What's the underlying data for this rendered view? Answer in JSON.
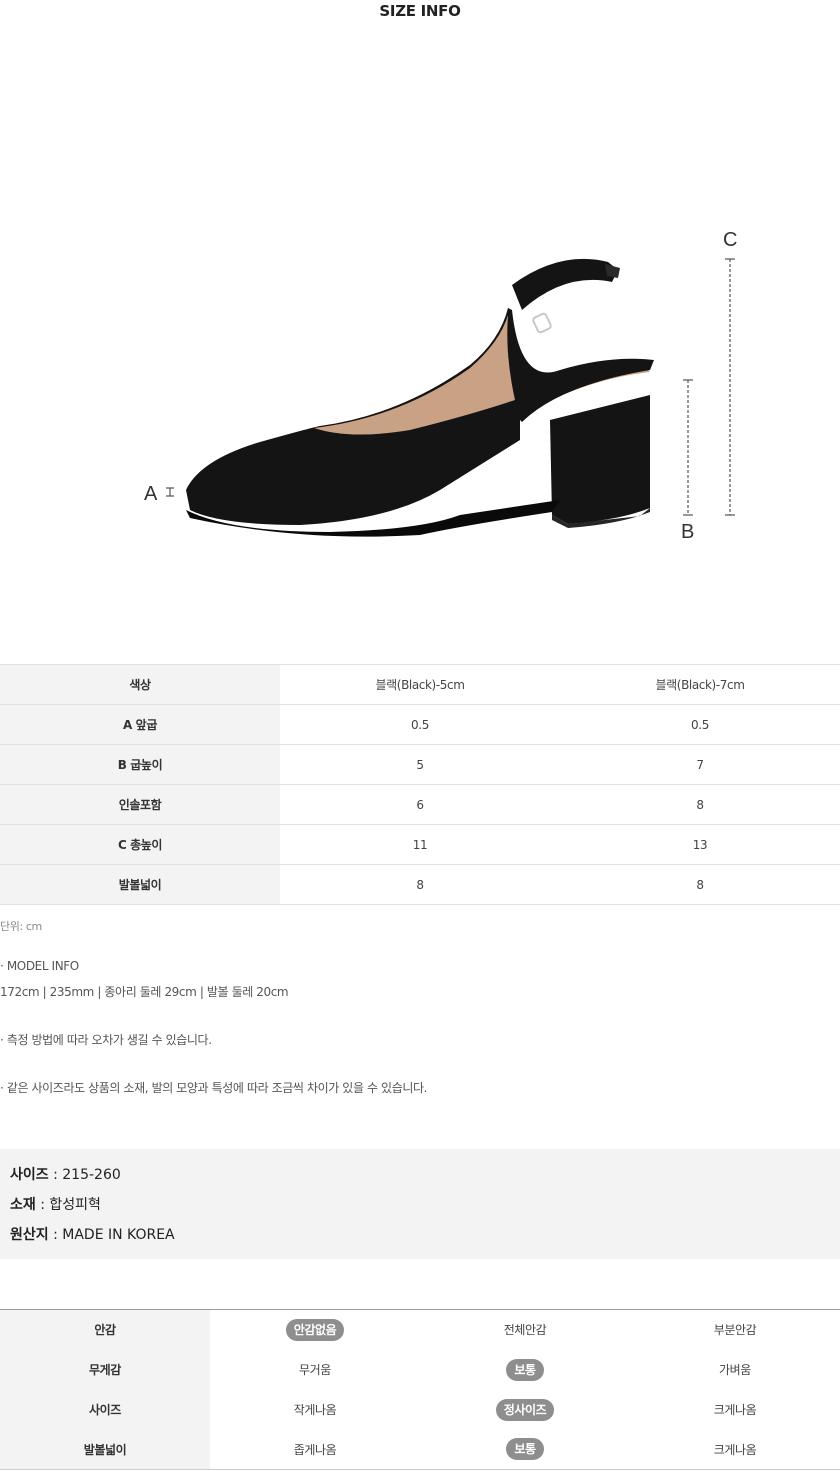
{
  "header": {
    "title": "SIZE INFO"
  },
  "diagram": {
    "label_a": "A",
    "label_b": "B",
    "label_c": "C",
    "colors": {
      "shoe": "#141414",
      "lining": "#c9a184",
      "guide": "#555555"
    }
  },
  "size_table": {
    "rows": [
      {
        "label": "색상",
        "v1": "블랙(Black)-5cm",
        "v2": "블랙(Black)-7cm"
      },
      {
        "label": "A 앞굽",
        "v1": "0.5",
        "v2": "0.5"
      },
      {
        "label": "B 굽높이",
        "v1": "5",
        "v2": "7"
      },
      {
        "label": "인솔포함",
        "v1": "6",
        "v2": "8"
      },
      {
        "label": "C 총높이",
        "v1": "11",
        "v2": "13"
      },
      {
        "label": "발볼넓이",
        "v1": "8",
        "v2": "8"
      }
    ]
  },
  "notes": {
    "unit": "단위: cm",
    "model_title": "· MODEL INFO",
    "model_info": "172cm | 235mm | 종아리 둘레 29cm | 발볼 둘레 20cm",
    "note1": "· 측정 방법에 따라 오차가 생길 수 있습니다.",
    "note2": "· 같은 사이즈라도 상품의 소재, 발의 모양과 특성에 따라 조금씩 차이가 있을 수 있습니다."
  },
  "spec": {
    "size_label": "사이즈",
    "size_value": " : 215-260",
    "material_label": "소재",
    "material_value": " : 합성피혁",
    "origin_label": "원산지",
    "origin_value": " : MADE IN KOREA"
  },
  "feel_table": {
    "rows": [
      {
        "label": "안감",
        "o1": "안감없음",
        "o2": "전체안감",
        "o3": "부분안감",
        "selected": 1
      },
      {
        "label": "무게감",
        "o1": "무거움",
        "o2": "보통",
        "o3": "가벼움",
        "selected": 2
      },
      {
        "label": "사이즈",
        "o1": "작게나옴",
        "o2": "정사이즈",
        "o3": "크게나옴",
        "selected": 2
      },
      {
        "label": "발볼넓이",
        "o1": "좁게나옴",
        "o2": "보통",
        "o3": "크게나옴",
        "selected": 2
      }
    ]
  }
}
